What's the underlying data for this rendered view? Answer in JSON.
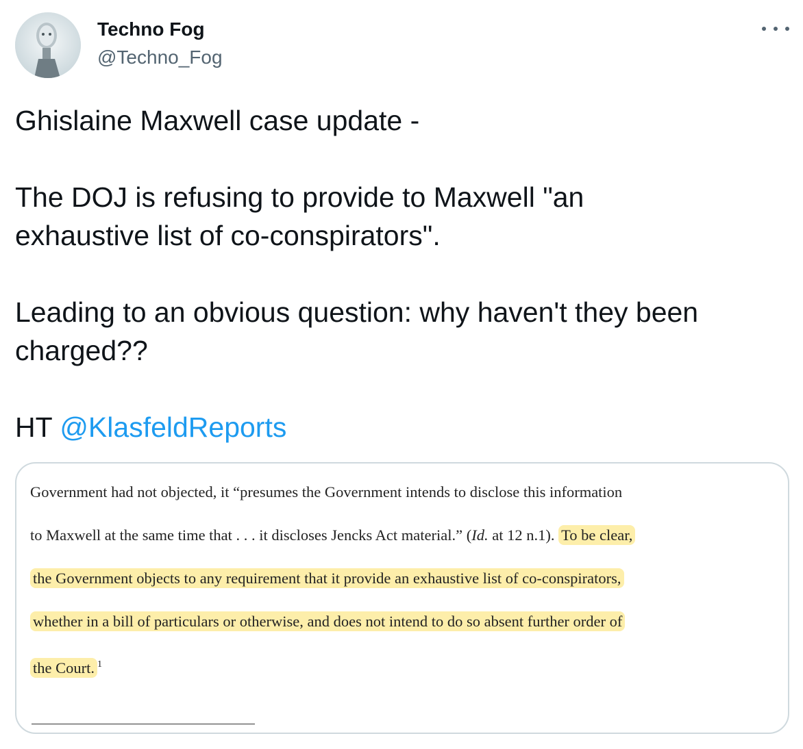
{
  "author": {
    "name": "Techno Fog",
    "handle": "@Techno_Fog"
  },
  "tweet": {
    "line1": "Ghislaine Maxwell case update -",
    "line2": "The DOJ is refusing to provide to Maxwell \"an",
    "line3": "exhaustive list of co-conspirators\".",
    "line4": "Leading to an obvious question: why haven't they been",
    "line5": "charged??",
    "ht_prefix": "HT ",
    "mention": "@KlasfeldReports"
  },
  "document": {
    "line1": "Government had not objected, it “presumes the Government intends to disclose this information",
    "line2_plain": "to Maxwell at the same time that . . . it discloses Jencks Act material.”  (",
    "line2_id": "Id.",
    "line2_after": " at 12 n.1).  ",
    "line2_hl": "To be clear,",
    "line3_hl": "the Government objects to any requirement that it provide an exhaustive list of co-conspirators,",
    "line4_hl": "whether in a bill of particulars or otherwise, and does not intend to do so absent further order of",
    "line5_hl": "the Court.",
    "footnote": "1"
  },
  "colors": {
    "link": "#1d9bf0",
    "highlight": "#fdeeaa",
    "secondary_text": "#536471"
  },
  "icons": {
    "more": "more-horizontal-icon"
  }
}
